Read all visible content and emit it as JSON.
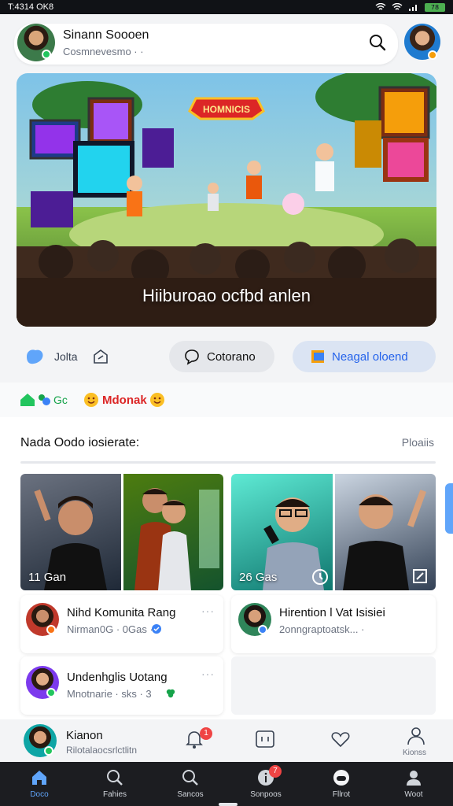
{
  "status_bar": {
    "time": "T:4314 OK8",
    "battery": "78"
  },
  "header": {
    "name": "Sinann Soooen",
    "subtitle": "Cosmnevesmo · ·"
  },
  "hero": {
    "logo_text": "HOMNICIS",
    "caption": "Hiiburoao ocfbd anlen"
  },
  "actions": {
    "like_label": "Jolta",
    "comment_label": "Cotorano",
    "share_label": "Neagal oloend"
  },
  "reactions": {
    "left_label": "Gc",
    "right_label": "Mdonak"
  },
  "section": {
    "title": "Nada Oodo iosierate:",
    "more_label": "Ploaiis",
    "thumbs": [
      {
        "count": "11 Gan"
      },
      {
        "count": ""
      },
      {
        "count": "26 Gas"
      },
      {
        "count": ""
      }
    ]
  },
  "cards": [
    {
      "title": "Nihd Komunita Rang",
      "subtitle": "Nirman0G · 0Gas ·"
    },
    {
      "title": "Hirention l Vat Isisiei",
      "subtitle": "2onngraptoatsk... ·"
    },
    {
      "title": "Undenhglis Uotang",
      "subtitle": "Mnotnarie · sks · 3"
    }
  ],
  "notification_row": {
    "title": "Kianon",
    "subtitle": "Rilotalaocsrlctlitn",
    "bell_badge": "1",
    "profile_label": "Kionss"
  },
  "tabs": [
    {
      "label": "Doco",
      "icon": "home-icon",
      "badge": ""
    },
    {
      "label": "Fahies",
      "icon": "search-icon",
      "badge": ""
    },
    {
      "label": "Sancos",
      "icon": "search-icon",
      "badge": ""
    },
    {
      "label": "Sonpoos",
      "icon": "info-icon",
      "badge": "7"
    },
    {
      "label": "Fllrot",
      "icon": "gamepad-icon",
      "badge": ""
    },
    {
      "label": "Woot",
      "icon": "person-icon",
      "badge": ""
    }
  ],
  "colors": {
    "accent": "#2563eb",
    "active_tab": "#60a5fa",
    "badge": "#ef4444",
    "tabbar": "#1c1d21"
  }
}
